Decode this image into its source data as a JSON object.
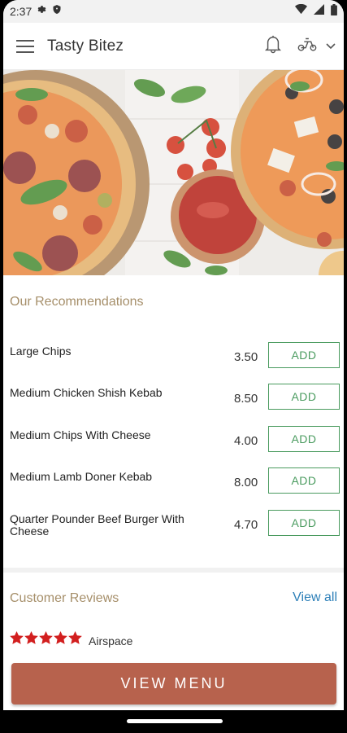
{
  "status_bar": {
    "time": "2:37",
    "icons": [
      "gear-icon",
      "shield-icon",
      "wifi-icon",
      "signal-icon",
      "battery-icon"
    ]
  },
  "app_bar": {
    "title": "Tasty Bitez",
    "icons": [
      "hamburger-menu-icon",
      "bell-icon",
      "delivery-scooter-icon",
      "chevron-down-icon"
    ]
  },
  "hero": {
    "description_icon": "pizza-hero-image"
  },
  "recommendations": {
    "title": "Our Recommendations",
    "add_label": "ADD",
    "items": [
      {
        "name": "Large Chips",
        "price": "3.50"
      },
      {
        "name": "Medium Chicken Shish Kebab",
        "price": "8.50"
      },
      {
        "name": "Medium Chips With Cheese",
        "price": "4.00"
      },
      {
        "name": "Medium Lamb Doner Kebab",
        "price": "8.00"
      },
      {
        "name": "Quarter Pounder Beef Burger With Cheese",
        "price": "4.70"
      }
    ]
  },
  "reviews": {
    "title": "Customer Reviews",
    "view_all": "View all",
    "first_review": {
      "rating": 5,
      "author": "Airspace"
    }
  },
  "cta": {
    "label": "VIEW MENU"
  },
  "colors": {
    "accent_gold": "#a68f6a",
    "add_green": "#4a9b5f",
    "link_blue": "#2c7fb8",
    "cta": "#b7624d",
    "star_red": "#d21f1f"
  }
}
